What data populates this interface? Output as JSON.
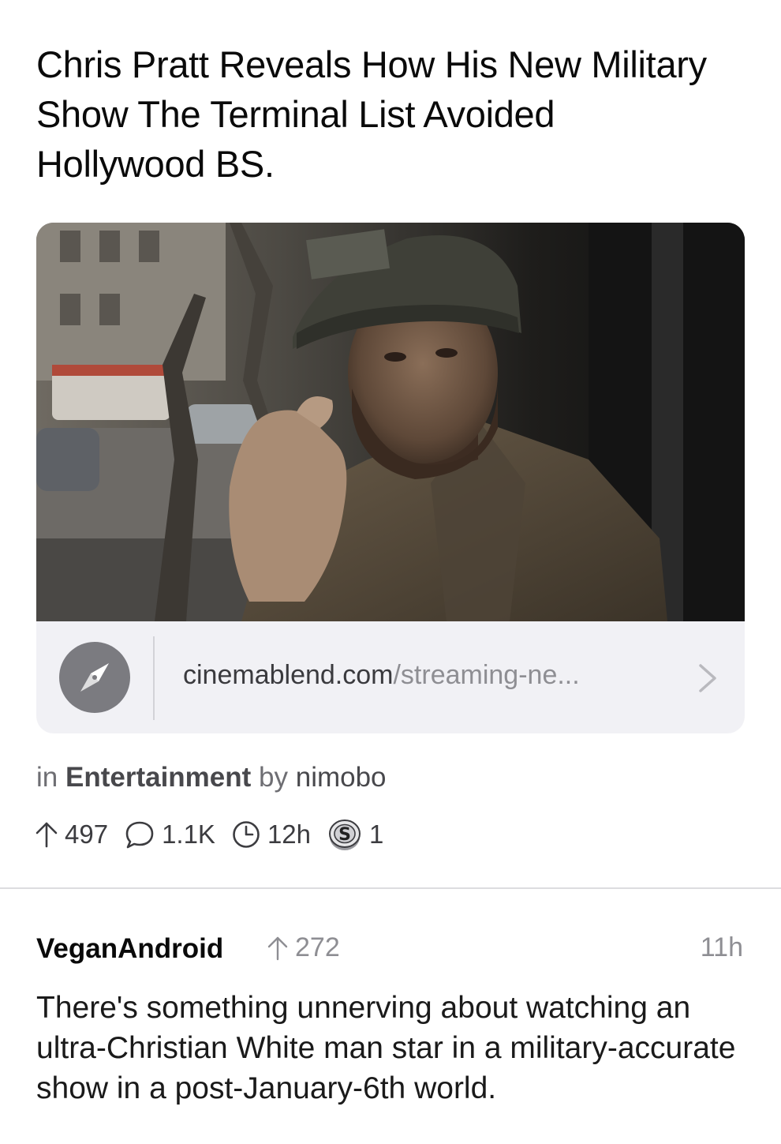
{
  "post": {
    "title": "Chris Pratt Reveals How His New Military Show The Terminal List Avoided Hollywood BS.",
    "link": {
      "domain": "cinemablend.com",
      "path": "/streaming-ne...",
      "icon": "compass-icon"
    },
    "meta": {
      "in_label": "in",
      "community": "Entertainment",
      "by_label": "by",
      "author": "nimobo"
    },
    "stats": {
      "upvotes": "497",
      "comments": "1.1K",
      "age": "12h",
      "awards": "1"
    }
  },
  "comment": {
    "author": "VeganAndroid",
    "upvotes": "272",
    "age": "11h",
    "body": "There's something unnerving about watching an ultra-Christian White man star in a military-accurate show in a post-January-6th world."
  },
  "colors": {
    "link_card_bg": "#f1f1f5",
    "muted_text": "#8e8e93",
    "compass_bg": "#7b7b80"
  }
}
